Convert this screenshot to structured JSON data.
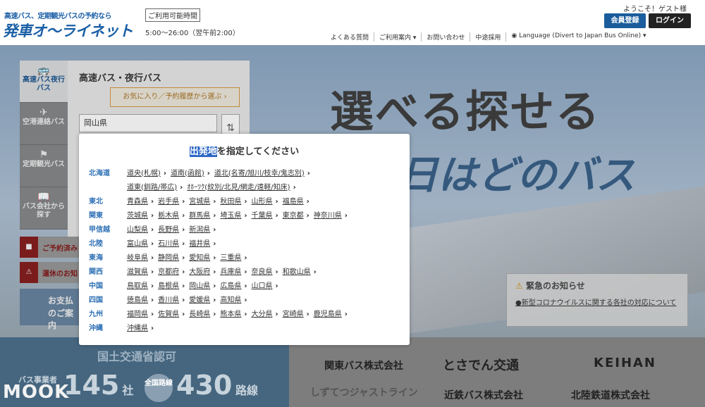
{
  "header": {
    "logo_sub": "高速バス、定期観光バスの予約なら",
    "logo_main": "発車オ〜ライネット",
    "hours_label": "ご利用可能時間",
    "hours_value": "5:00〜26:00（翌午前2:00）",
    "welcome": "ようこそ！ゲスト様",
    "register_label": "会員登録",
    "login_label": "ログイン",
    "nav": [
      "よくある質問",
      "ご利用案内 ▾",
      "お問い合わせ",
      "中途採用",
      "◉ Language (Divert to Japan Bus Online) ▾"
    ]
  },
  "hero": {
    "title": "選べる探せる",
    "subtitle": "日はどのバス"
  },
  "side_tabs": [
    {
      "icon": "🚌",
      "label": "高速バス夜行バス",
      "top": "HIGHWAY"
    },
    {
      "icon": "✈",
      "label": "空港連絡バス"
    },
    {
      "icon": "⚑",
      "label": "定期観光バス"
    },
    {
      "icon": "📖",
      "label": "バス会社から探す"
    }
  ],
  "search_panel": {
    "title": "高速バス・夜行バス",
    "fav_button": "お気に入り／予約履歴から選ぶ ›",
    "prefecture": "岡山県"
  },
  "notices": {
    "reservation": "ご予約済み",
    "suspension": "運休のお知"
  },
  "payment": {
    "line1": "お支払",
    "line2": "のご案内"
  },
  "emergency": {
    "title": "緊急のお知らせ",
    "link": "●新型コロナウイルスに関する各社の対応について"
  },
  "certification": {
    "title": "国土交通省認可",
    "count1_text": "145",
    "count1_unit": "社",
    "count1_label": "バス事業者",
    "count2_label": "全国路線",
    "count2_text": "430",
    "count2_unit": "路線"
  },
  "partners": [
    "関東バス株式会社",
    "とさでん交通",
    "KEIHAN",
    "しずてつジャストライン",
    "近鉄バス株式会社",
    "北陸鉄道株式会社"
  ],
  "watermark": "MOOK",
  "modal": {
    "title_highlight": "出発地",
    "title_rest": "を指定してください",
    "regions": [
      {
        "name": "北海道",
        "prefs": [
          "道央(札幌)",
          "道南(函館)",
          "道北(名寄/旭川/枝幸/鬼志別)"
        ]
      },
      {
        "name": "",
        "prefs": [
          "道東(釧路/帯広)",
          "ｵﾎｰﾂｸ(紋別/北見/網走/遠軽/知床)"
        ]
      },
      {
        "name": "東北",
        "prefs": [
          "青森県",
          "岩手県",
          "宮城県",
          "秋田県",
          "山形県",
          "福島県"
        ]
      },
      {
        "name": "関東",
        "prefs": [
          "茨城県",
          "栃木県",
          "群馬県",
          "埼玉県",
          "千葉県",
          "東京都",
          "神奈川県"
        ]
      },
      {
        "name": "甲信越",
        "prefs": [
          "山梨県",
          "長野県",
          "新潟県"
        ]
      },
      {
        "name": "北陸",
        "prefs": [
          "富山県",
          "石川県",
          "福井県"
        ]
      },
      {
        "name": "東海",
        "prefs": [
          "岐阜県",
          "静岡県",
          "愛知県",
          "三重県"
        ]
      },
      {
        "name": "関西",
        "prefs": [
          "滋賀県",
          "京都府",
          "大阪府",
          "兵庫県",
          "奈良県",
          "和歌山県"
        ]
      },
      {
        "name": "中国",
        "prefs": [
          "鳥取県",
          "島根県",
          "岡山県",
          "広島県",
          "山口県"
        ]
      },
      {
        "name": "四国",
        "prefs": [
          "徳島県",
          "香川県",
          "愛媛県",
          "高知県"
        ]
      },
      {
        "name": "九州",
        "prefs": [
          "福岡県",
          "佐賀県",
          "長崎県",
          "熊本県",
          "大分県",
          "宮崎県",
          "鹿児島県"
        ]
      },
      {
        "name": "沖縄",
        "prefs": [
          "沖縄県"
        ]
      }
    ]
  }
}
